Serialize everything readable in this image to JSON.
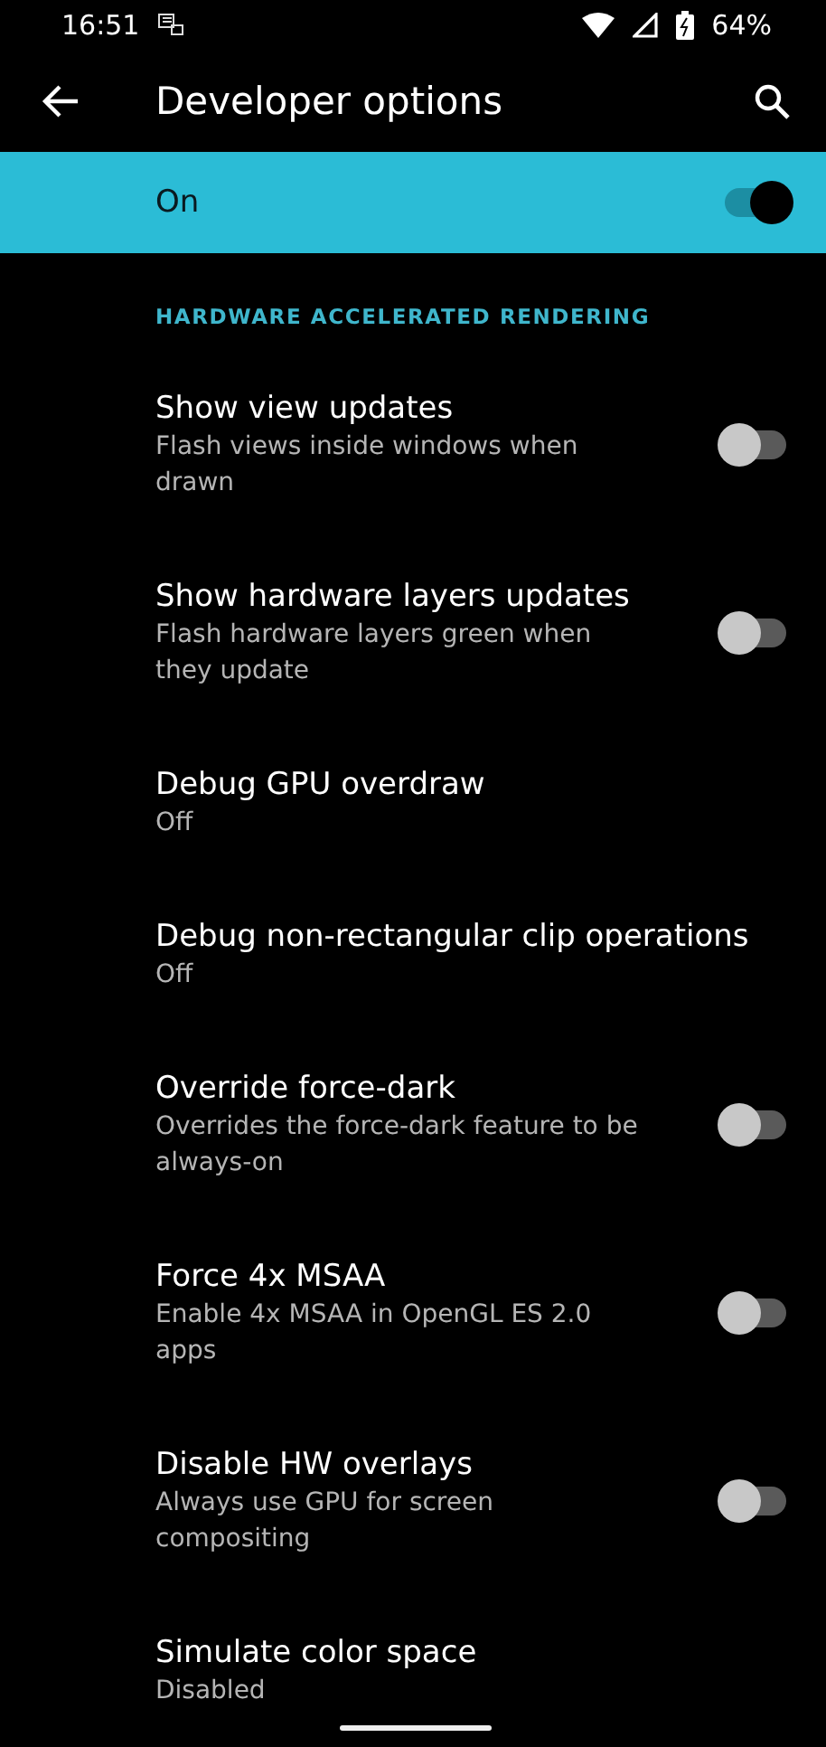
{
  "status_bar": {
    "time": "16:51",
    "battery": "64%"
  },
  "toolbar": {
    "title": "Developer options"
  },
  "master_switch": {
    "label": "On",
    "on": true
  },
  "section": {
    "title": "HARDWARE ACCELERATED RENDERING"
  },
  "items": [
    {
      "kind": "switch",
      "title": "Show view updates",
      "summary": "Flash views inside windows when drawn",
      "on": false
    },
    {
      "kind": "switch",
      "title": "Show hardware layers updates",
      "summary": "Flash hardware layers green when they update",
      "on": false
    },
    {
      "kind": "text",
      "title": "Debug GPU overdraw",
      "summary": "Off"
    },
    {
      "kind": "text",
      "title": "Debug non-rectangular clip operations",
      "summary": "Off"
    },
    {
      "kind": "switch",
      "title": "Override force-dark",
      "summary": "Overrides the force-dark feature to be always-on",
      "on": false
    },
    {
      "kind": "switch",
      "title": "Force 4x MSAA",
      "summary": "Enable 4x MSAA in OpenGL ES 2.0 apps",
      "on": false
    },
    {
      "kind": "switch",
      "title": "Disable HW overlays",
      "summary": "Always use GPU for screen compositing",
      "on": false
    },
    {
      "kind": "text",
      "title": "Simulate color space",
      "summary": "Disabled"
    }
  ]
}
